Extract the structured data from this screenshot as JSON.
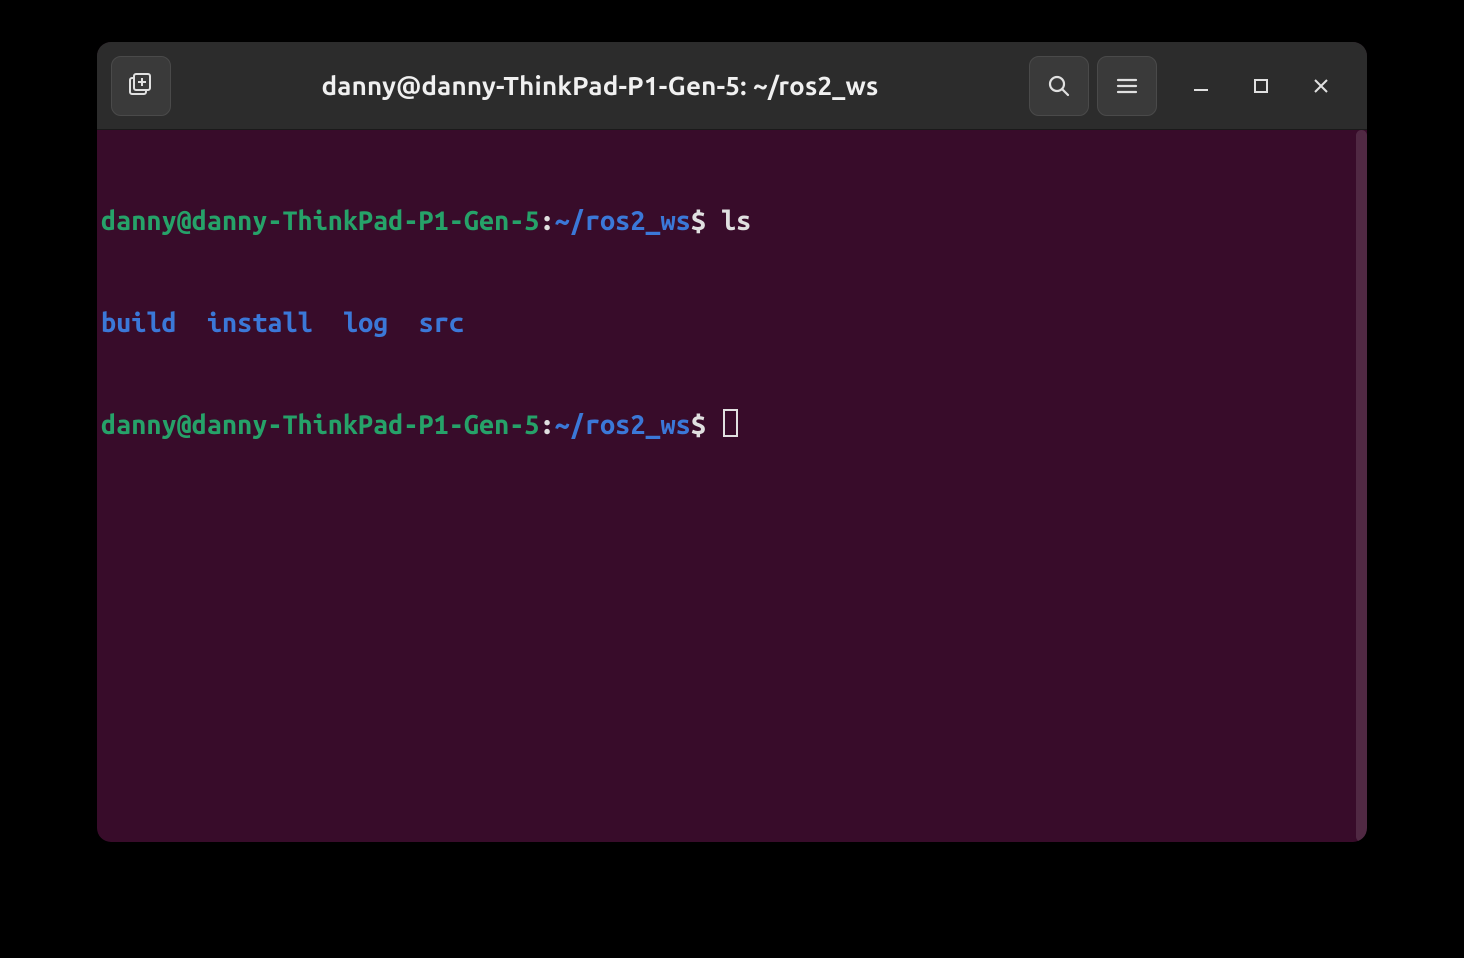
{
  "window": {
    "title": "danny@danny-ThinkPad-P1-Gen-5: ~/ros2_ws"
  },
  "prompt": {
    "user_host": "danny@danny-ThinkPad-P1-Gen-5",
    "colon": ":",
    "path": "~/ros2_ws",
    "symbol": "$"
  },
  "lines": [
    {
      "command": "ls"
    }
  ],
  "ls_output": {
    "items": [
      "build",
      "install",
      "log",
      "src"
    ]
  }
}
